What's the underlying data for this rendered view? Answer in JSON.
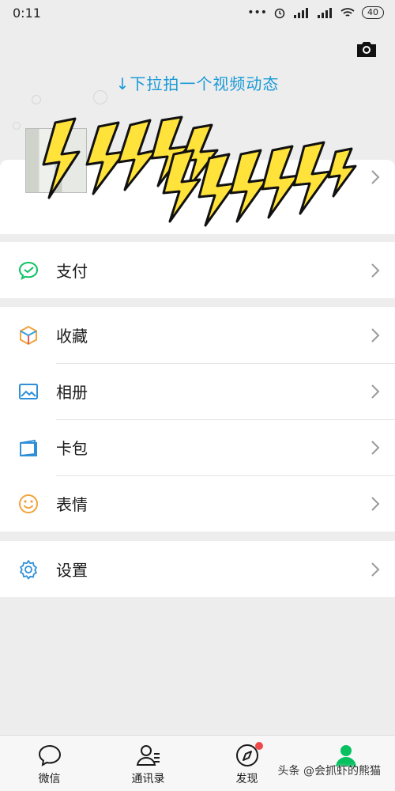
{
  "status_bar": {
    "time": "0:11",
    "battery": "40"
  },
  "header": {
    "pull_hint": "↓下拉拍一个视频动态"
  },
  "menu": {
    "pay": "支付",
    "favorites": "收藏",
    "album": "相册",
    "cards": "卡包",
    "stickers": "表情",
    "settings": "设置"
  },
  "tabbar": {
    "chats": "微信",
    "contacts": "通讯录",
    "discover": "发现",
    "me": ""
  },
  "watermark": "头条 @会抓虾的熊猫",
  "colors": {
    "accent_blue": "#1b9ad8",
    "wechat_green": "#07c160",
    "badge_red": "#f04848",
    "sticker_yellow": "#ffe23a"
  }
}
